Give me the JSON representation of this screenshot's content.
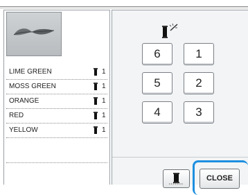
{
  "colors": [
    {
      "name": "LIME GREEN",
      "count": "1"
    },
    {
      "name": "MOSS GREEN",
      "count": "1"
    },
    {
      "name": "ORANGE",
      "count": "1"
    },
    {
      "name": "RED",
      "count": "1"
    },
    {
      "name": "YELLOW",
      "count": "1"
    }
  ],
  "numpad": {
    "b6": "6",
    "b1": "1",
    "b5": "5",
    "b2": "2",
    "b4": "4",
    "b3": "3"
  },
  "close_label": "CLOSE",
  "accent": "#1d8fe0"
}
